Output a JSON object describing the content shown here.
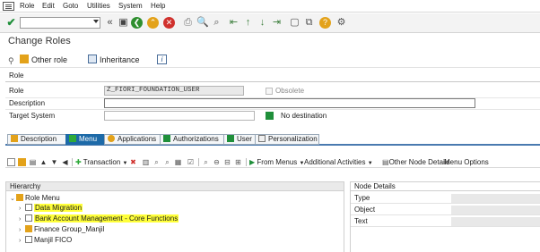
{
  "menubar": {
    "items": [
      "Role",
      "Edit",
      "Goto",
      "Utilities",
      "System",
      "Help"
    ]
  },
  "toolbar": {
    "command_field": "",
    "icons": [
      "confirm-icon",
      "dropdown-icon",
      "first-icon",
      "save-icon",
      "back-icon",
      "exit-icon",
      "cancel-icon",
      "print-icon",
      "find-icon",
      "find-next-icon",
      "first-page-icon",
      "previous-page-icon",
      "next-page-icon",
      "last-page-icon",
      "new-session-icon",
      "shortcut-icon",
      "help-icon",
      "customize-icon"
    ]
  },
  "page": {
    "title": "Change Roles"
  },
  "app_toolbar": {
    "other_role": "Other role",
    "inheritance": "Inheritance",
    "info": "i"
  },
  "role_section": {
    "header": "Role",
    "role_label": "Role",
    "role_value": "Z_FIORI_FOUNDATION_USER",
    "obsolete_label": "Obsolete",
    "description_label": "Description",
    "description_value": "",
    "target_system_label": "Target System",
    "target_system_value": "",
    "no_destination_label": "No destination"
  },
  "tabs": [
    {
      "label": "Description",
      "selected": false
    },
    {
      "label": "Menu",
      "selected": true
    },
    {
      "label": "Applications",
      "selected": false
    },
    {
      "label": "Authorizations",
      "selected": false
    },
    {
      "label": "User",
      "selected": false
    },
    {
      "label": "Personalization",
      "selected": false
    }
  ],
  "tree_toolbar": {
    "transaction": "Transaction",
    "from_menus": "From Menus",
    "additional_activities": "Additional Activities",
    "other_node_details": "Other Node Details",
    "menu_options": "Menu Options"
  },
  "hierarchy": {
    "header": "Hierarchy",
    "root": "Role Menu",
    "nodes": [
      {
        "label": "Data Migration",
        "highlighted": true
      },
      {
        "label": "Bank Account Management - Core Functions",
        "highlighted": true
      },
      {
        "label": "Finance Group_Manjil",
        "highlighted": false
      },
      {
        "label": "Manjil FICO",
        "highlighted": false
      }
    ]
  },
  "node_details": {
    "header": "Node Details",
    "rows": [
      "Type",
      "Object",
      "Text"
    ]
  },
  "colors": {
    "tab_selected": "#1d6aa8",
    "status_green": "#1f8f3a",
    "highlight": "#ffff3a"
  }
}
